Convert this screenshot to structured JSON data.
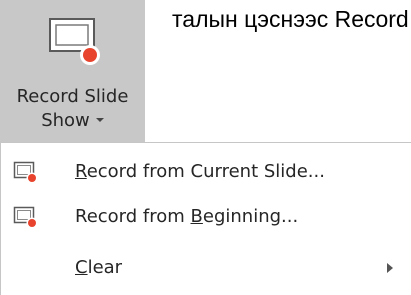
{
  "background_text": "талын цэснээс Record",
  "ribbon": {
    "button": {
      "label_line1": "Record Slide",
      "label_line2": "Show",
      "icon": "record-slide-show-icon",
      "pressed_color": "#c8c8c8"
    }
  },
  "menu": {
    "items": [
      {
        "label_pre": "",
        "label_key": "R",
        "label_post": "ecord from Current Slide...",
        "icon": "record-slide-icon"
      },
      {
        "label_pre": "Record from ",
        "label_key": "B",
        "label_post": "eginning...",
        "icon": "record-slide-icon"
      },
      {
        "label_pre": "",
        "label_key": "C",
        "label_post": "lear",
        "icon": "chevron-right-icon"
      }
    ]
  },
  "colors": {
    "record_dot": "#e8432d",
    "border": "#c6c6c6"
  }
}
